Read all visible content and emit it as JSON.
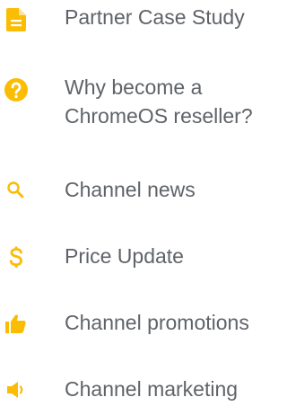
{
  "colors": {
    "icon": "#fbbc04",
    "text": "#5f6368",
    "background": "#ffffff"
  },
  "menu": {
    "items": [
      {
        "icon": "document-icon",
        "label": "Partner Case Study"
      },
      {
        "icon": "help-circle-icon",
        "label_line1": "Why become a",
        "label_line2": "ChromeOS reseller?"
      },
      {
        "icon": "search-icon",
        "label": "Channel news"
      },
      {
        "icon": "dollar-icon",
        "label": "Price Update"
      },
      {
        "icon": "thumbs-up-icon",
        "label": "Channel promotions"
      },
      {
        "icon": "megaphone-icon",
        "label": "Channel marketing"
      }
    ]
  }
}
